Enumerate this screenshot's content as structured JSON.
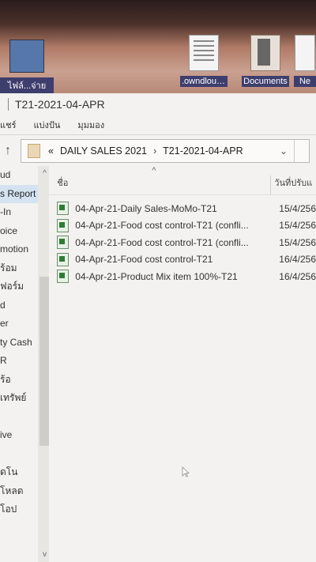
{
  "desktop": {
    "icons": [
      {
        "label": "ไฟล์...จ่าย"
      },
      {
        "label": ".owndloudi..."
      },
      {
        "label": "Documents"
      },
      {
        "label": "Ne"
      }
    ]
  },
  "window": {
    "title": "T21-2021-04-APR",
    "ribbon": [
      "แชร์",
      "แบ่งปัน",
      "มุมมอง"
    ],
    "address": {
      "prefix": "«",
      "crumbs": [
        "DAILY SALES 2021",
        "T21-2021-04-APR"
      ]
    },
    "nav_items": [
      {
        "label": "ud"
      },
      {
        "label": "s Report",
        "active": true
      },
      {
        "label": "-In"
      },
      {
        "label": "oice"
      },
      {
        "label": "motion"
      },
      {
        "label": "ร้อม"
      },
      {
        "label": "ฟอร์ม"
      },
      {
        "label": "d"
      },
      {
        "label": "er"
      },
      {
        "label": "ty Cash"
      },
      {
        "label": "R"
      },
      {
        "label": "ร้อ"
      },
      {
        "label": "เทรัพย์"
      },
      {
        "label": ""
      },
      {
        "label": "ive"
      },
      {
        "label": ""
      },
      {
        "label": "ดโน"
      },
      {
        "label": "โหลด"
      },
      {
        "label": "โอป"
      }
    ],
    "columns": {
      "name": "ชื่อ",
      "date": "วันที่ปรับแ"
    },
    "files": [
      {
        "name": "04-Apr-21-Daily Sales-MoMo-T21",
        "date": "15/4/256"
      },
      {
        "name": "04-Apr-21-Food cost control-T21 (confli...",
        "date": "15/4/256"
      },
      {
        "name": "04-Apr-21-Food cost control-T21 (confli...",
        "date": "15/4/256"
      },
      {
        "name": "04-Apr-21-Food cost control-T21",
        "date": "16/4/256"
      },
      {
        "name": "04-Apr-21-Product Mix item 100%-T21",
        "date": "16/4/256"
      }
    ]
  }
}
